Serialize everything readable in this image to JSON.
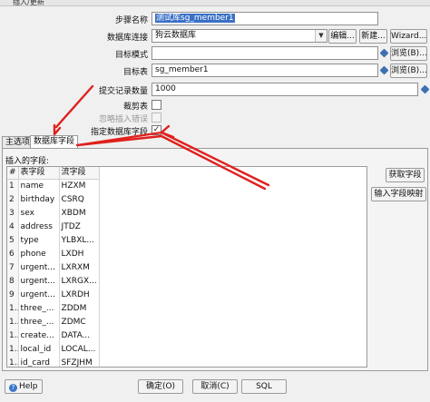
{
  "window": {
    "title": "插入/更新"
  },
  "form": {
    "step_name": {
      "label": "步骤名称",
      "value": "测试库sg_member1"
    },
    "connection": {
      "label": "数据库连接",
      "value": "狗云数据库",
      "edit": "编辑...",
      "new": "新建...",
      "wizard": "Wizard..."
    },
    "target_schema": {
      "label": "目标模式",
      "value": "",
      "browse": "浏览(B)..."
    },
    "target_table": {
      "label": "目标表",
      "value": "sg_member1",
      "browse": "浏览(B)..."
    },
    "commit_size": {
      "label": "提交记录数量",
      "value": "1000"
    },
    "truncate": {
      "label": "裁剪表",
      "checked": false
    },
    "ignore_errors": {
      "label": "忽略插入错误",
      "checked": false,
      "disabled": true
    },
    "specify_fields": {
      "label": "指定数据库字段",
      "checked": true,
      "mark": "✓"
    }
  },
  "tabs": [
    {
      "label": "主选项",
      "active": false
    },
    {
      "label": "数据库字段",
      "active": true
    }
  ],
  "fields_panel": {
    "title": "插入的字段:",
    "headers": [
      "#",
      "表字段",
      "流字段"
    ],
    "rows": [
      {
        "n": "1",
        "table_field": "name",
        "stream_field": "HZXM"
      },
      {
        "n": "2",
        "table_field": "birthday",
        "stream_field": "CSRQ"
      },
      {
        "n": "3",
        "table_field": "sex",
        "stream_field": "XBDM"
      },
      {
        "n": "4",
        "table_field": "address",
        "stream_field": "JTDZ"
      },
      {
        "n": "5",
        "table_field": "type",
        "stream_field": "YLBXL..."
      },
      {
        "n": "6",
        "table_field": "phone",
        "stream_field": "LXDH"
      },
      {
        "n": "7",
        "table_field": "urgent...",
        "stream_field": "LXRXM"
      },
      {
        "n": "8",
        "table_field": "urgent...",
        "stream_field": "LXRGX..."
      },
      {
        "n": "9",
        "table_field": "urgent...",
        "stream_field": "LXRDH"
      },
      {
        "n": "1...",
        "table_field": "three_...",
        "stream_field": "ZDDM"
      },
      {
        "n": "1...",
        "table_field": "three_...",
        "stream_field": "ZDMC"
      },
      {
        "n": "1...",
        "table_field": "create...",
        "stream_field": "DATA..."
      },
      {
        "n": "1...",
        "table_field": "local_id",
        "stream_field": "LOCAL..."
      },
      {
        "n": "1...",
        "table_field": "id_card",
        "stream_field": "SFZJHM"
      }
    ],
    "get_fields": "获取字段",
    "input_mapping": "输入字段映射"
  },
  "footer": {
    "help": "Help",
    "ok": "确定(O)",
    "cancel": "取消(C)",
    "sql": "SQL"
  },
  "colors": {
    "selection": "#3a70c6",
    "arrow": "#e0201c",
    "variable_icon": "#3d6fb4"
  }
}
